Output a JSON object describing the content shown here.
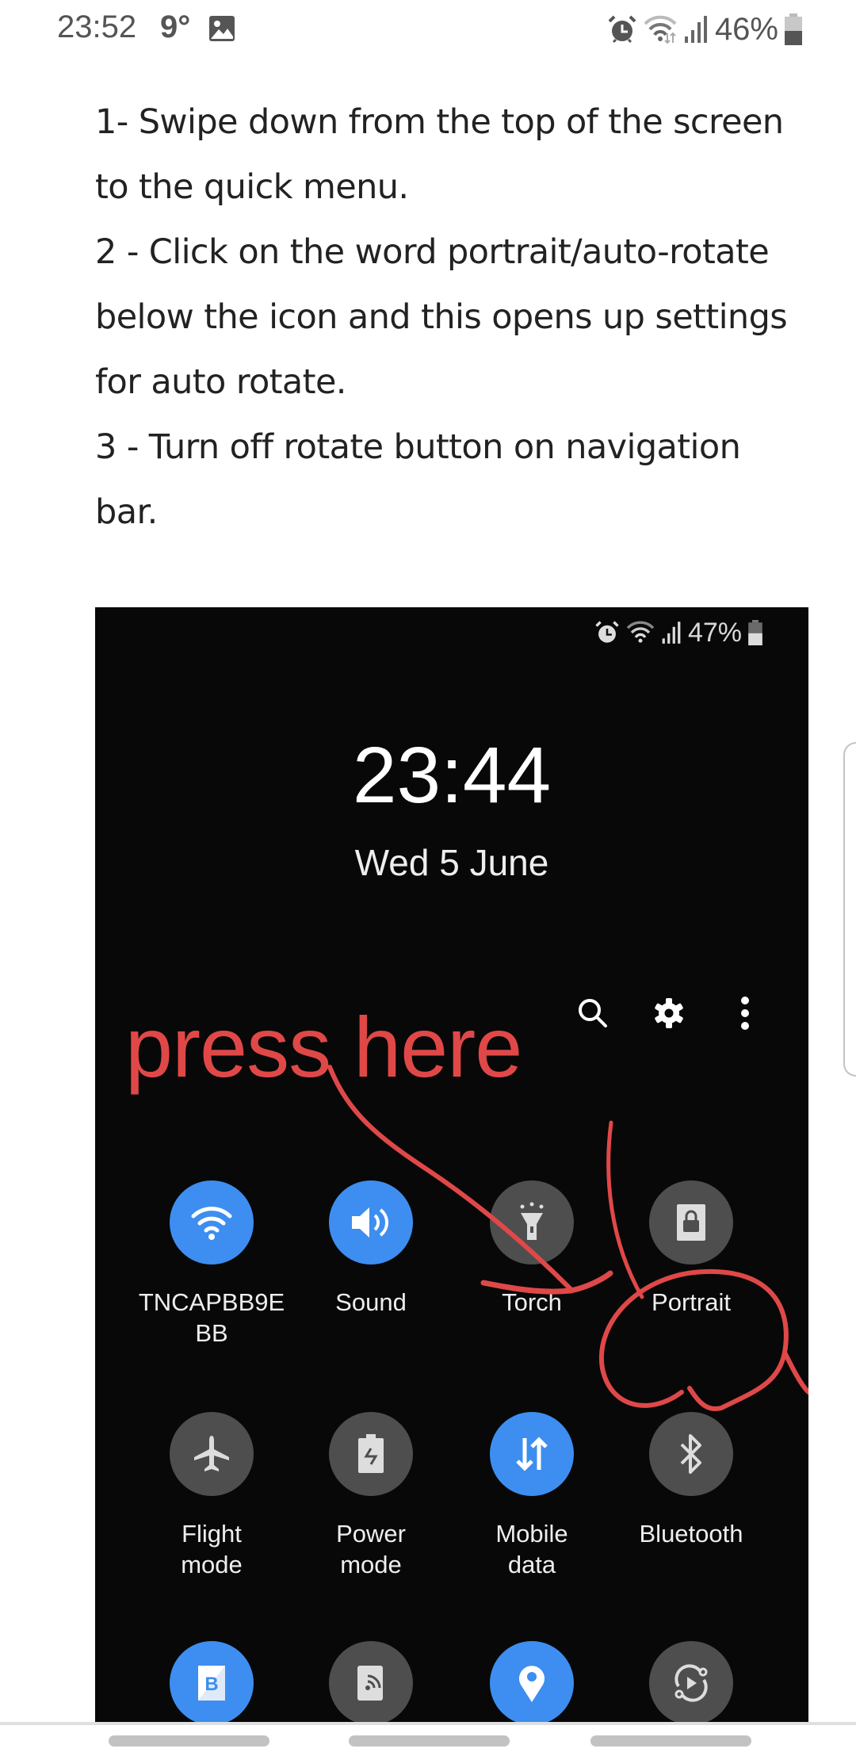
{
  "status_bar": {
    "time": "23:52",
    "temperature": "9°",
    "notification_icon": "gallery-icon",
    "icons": [
      "alarm-icon",
      "wifi-icon",
      "signal-icon"
    ],
    "battery_percent": "46%",
    "battery_level": 0.46
  },
  "article": {
    "lines": [
      "1- Swipe down from the top of the screen",
      "to the quick menu.",
      "2 - Click on the word portrait/auto-rotate",
      "below the icon and this opens up settings",
      "for auto rotate.",
      "3 - Turn off rotate button on navigation",
      "bar."
    ]
  },
  "embedded_screenshot": {
    "status": {
      "icons": [
        "alarm-icon",
        "wifi-icon",
        "signal-icon"
      ],
      "battery_percent": "47%",
      "battery_level": 0.47
    },
    "clock": "23:44",
    "date": "Wed 5 June",
    "actions": [
      "search-icon",
      "settings-gear-icon",
      "more-options-icon"
    ],
    "annotation_text": "press here",
    "annotation_color": "#e04848",
    "tiles": [
      {
        "label_1": "TNCAPBB9E",
        "label_2": "BB",
        "icon": "wifi-icon",
        "active": true
      },
      {
        "label_1": "Sound",
        "label_2": "",
        "icon": "sound-icon",
        "active": true
      },
      {
        "label_1": "Torch",
        "label_2": "",
        "icon": "torch-icon",
        "active": false
      },
      {
        "label_1": "Portrait",
        "label_2": "",
        "icon": "portrait-lock-icon",
        "active": false
      },
      {
        "label_1": "Flight",
        "label_2": "mode",
        "icon": "airplane-icon",
        "active": false
      },
      {
        "label_1": "Power",
        "label_2": "mode",
        "icon": "power-mode-icon",
        "active": false
      },
      {
        "label_1": "Mobile",
        "label_2": "data",
        "icon": "mobile-data-icon",
        "active": true
      },
      {
        "label_1": "Bluetooth",
        "label_2": "",
        "icon": "bluetooth-icon",
        "active": false
      },
      {
        "label_1": "",
        "label_2": "",
        "icon": "blue-light-filter-icon",
        "active": true
      },
      {
        "label_1": "",
        "label_2": "",
        "icon": "nfc-icon",
        "active": false
      },
      {
        "label_1": "",
        "label_2": "",
        "icon": "location-icon",
        "active": true
      },
      {
        "label_1": "",
        "label_2": "",
        "icon": "smart-view-icon",
        "active": false
      }
    ],
    "accent_color": "#3d8ef0"
  }
}
